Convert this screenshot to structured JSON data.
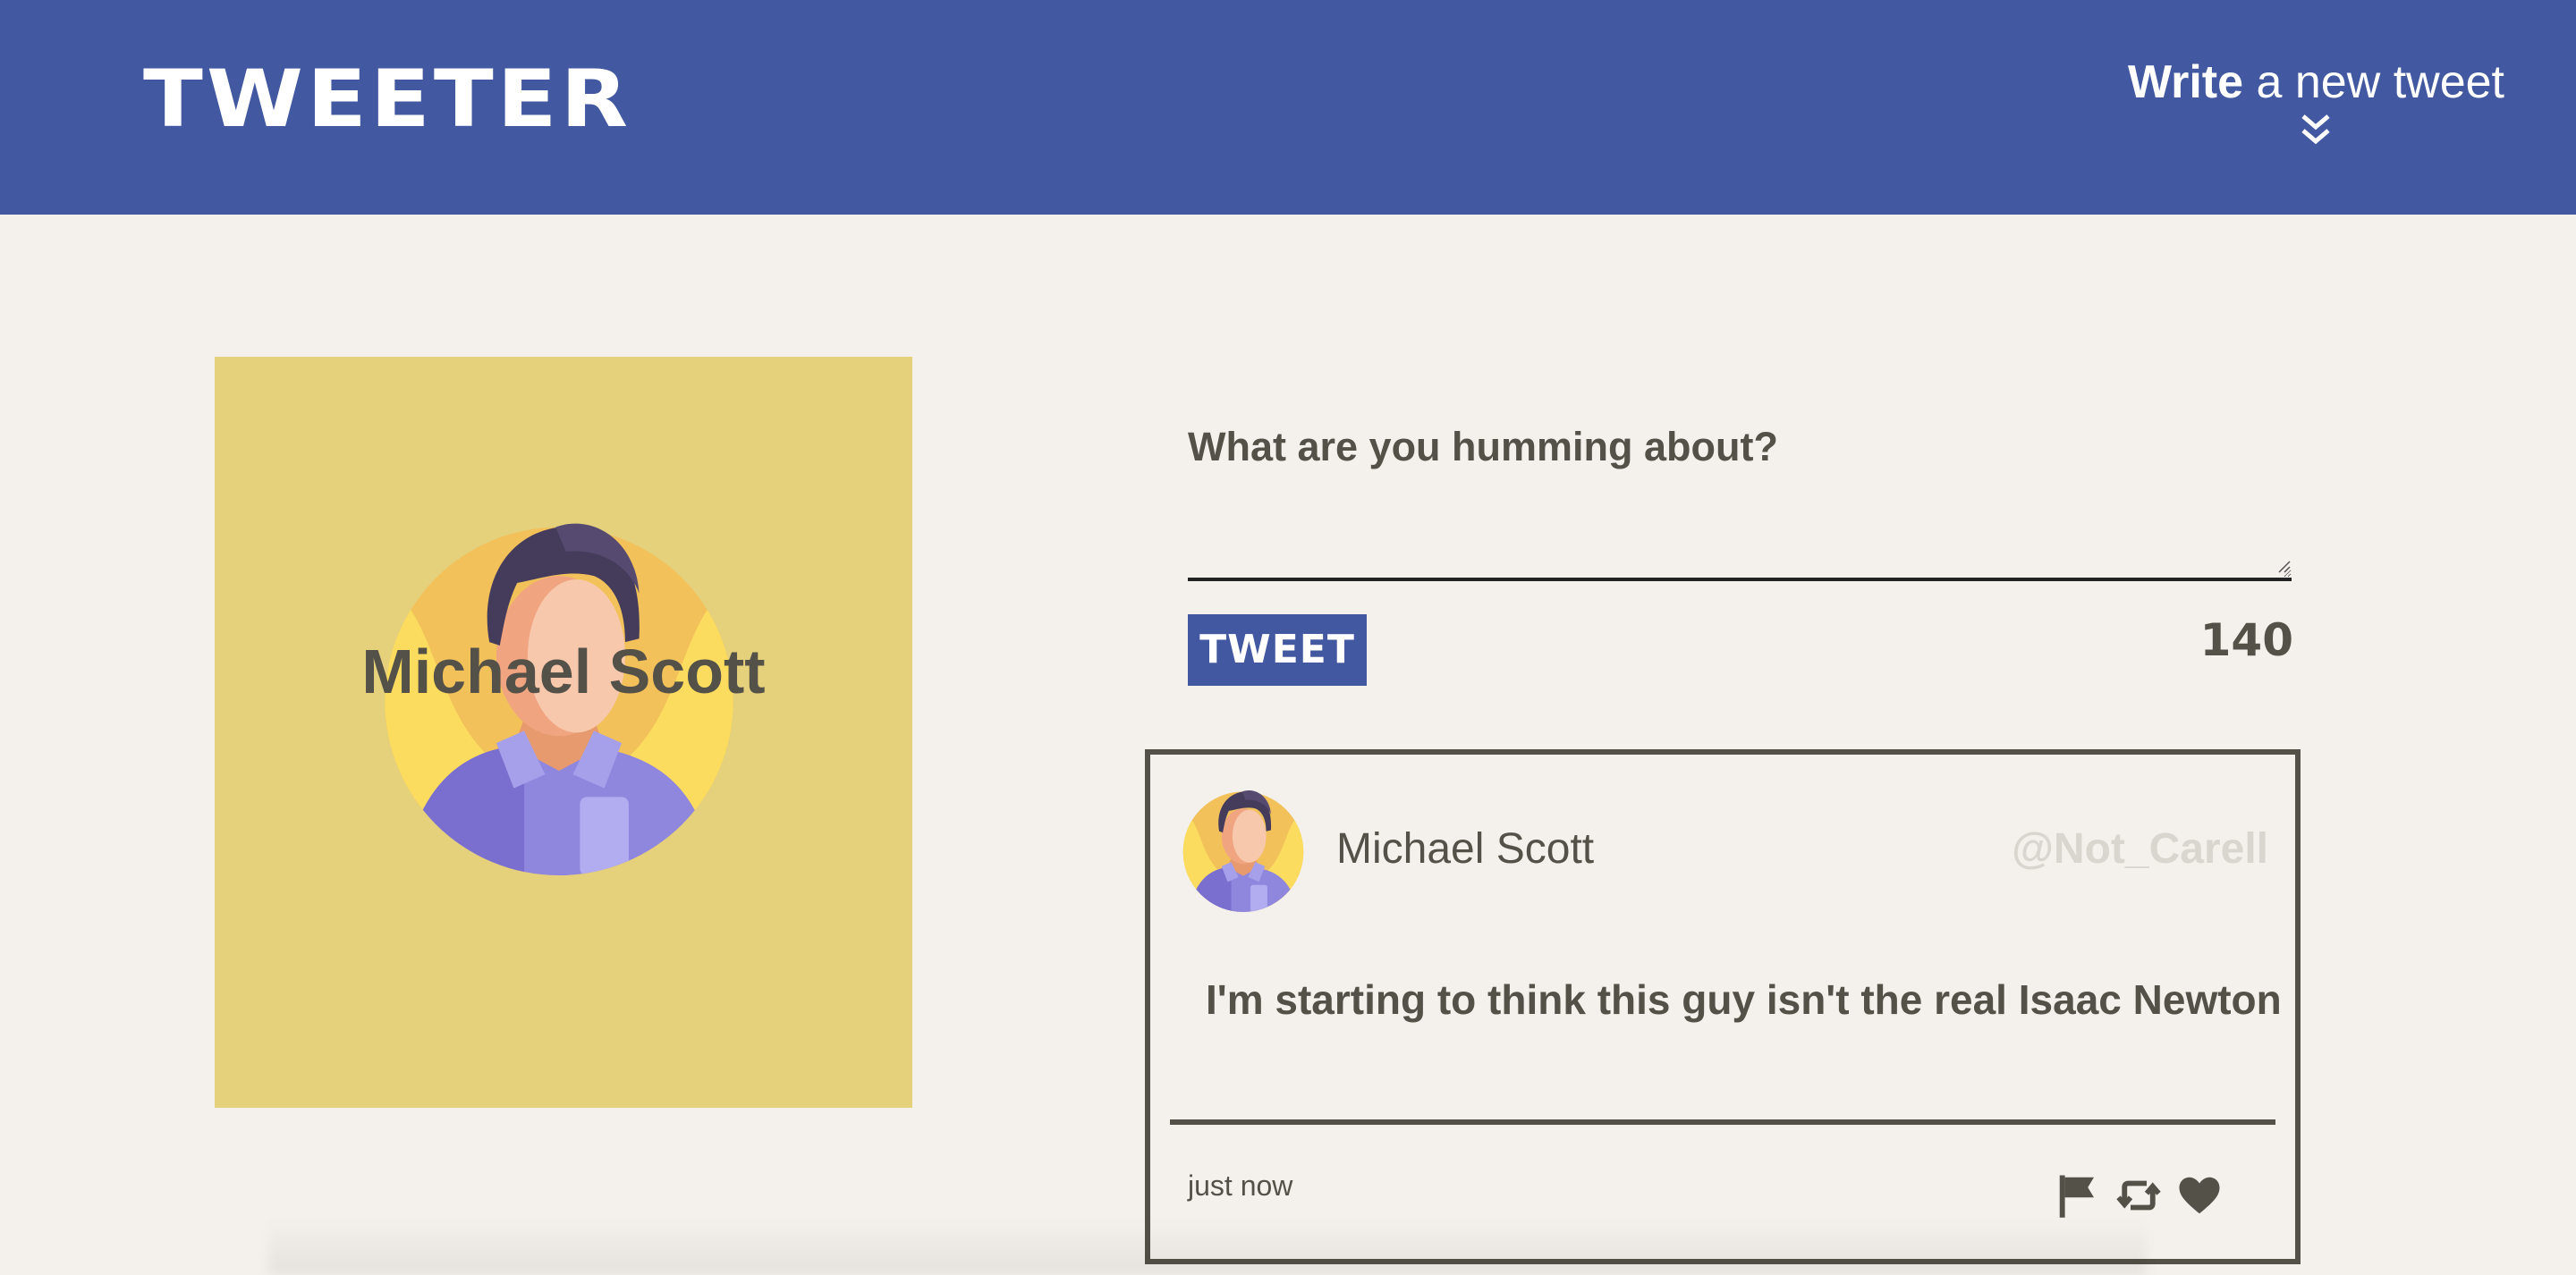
{
  "app": {
    "title": "TWEETER"
  },
  "nav": {
    "write_bold": "Write",
    "write_rest": " a new tweet",
    "chevron_icon": "double-chevron-down-icon"
  },
  "profile": {
    "name": "Michael Scott",
    "avatar_icon": "man-avatar-icon"
  },
  "compose": {
    "label": "What are you humming about?",
    "value": "",
    "submit_label": "TWEET",
    "char_count": "140"
  },
  "tweets": [
    {
      "name": "Michael Scott",
      "handle": "@Not_Carell",
      "content": "I'm starting to think this guy isn't the real Isaac Newton",
      "time": "just now",
      "actions": [
        "flag-icon",
        "retweet-icon",
        "heart-icon"
      ]
    }
  ],
  "colors": {
    "header": "#4258a0",
    "background": "#f4f1ec",
    "profile_card": "#e5d07c",
    "text": "#545149",
    "handle": "#d9d6d0"
  }
}
